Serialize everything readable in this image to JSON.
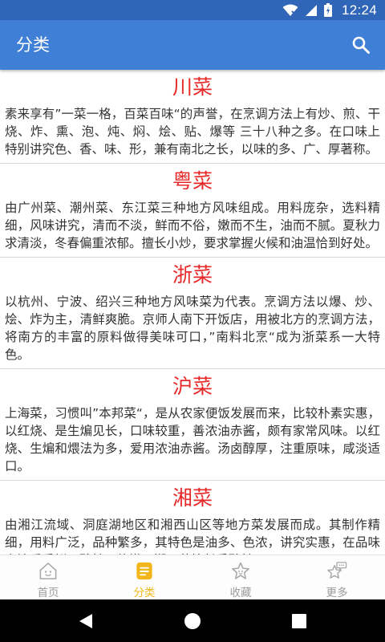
{
  "status_bar": {
    "time": "12:24"
  },
  "app_bar": {
    "title": "分类",
    "search_icon": "search-icon"
  },
  "cuisines": [
    {
      "name": "川菜",
      "desc": "素来享有”一菜一格，百菜百味“的声誉，在烹调方法上有炒、煎、干烧、炸、熏、泡、炖、焖、烩、贴、爆等 三十八种之多。在口味上特别讲究色、香、味、形，兼有南北之长，以味的多、广、厚著称。"
    },
    {
      "name": "粤菜",
      "desc": "由广州菜、潮州菜、东江菜三种地方风味组成。用料庞杂，选料精细，风味讲究，清而不淡，鲜而不俗，嫩而不生，油而不腻。夏秋力求清淡，冬春偏重浓郁。擅长小炒，要求掌握火候和油温恰到好处。"
    },
    {
      "name": "浙菜",
      "desc": "以杭州、宁波、绍兴三种地方风味菜为代表。烹调方法以爆、炒、烩、炸为主，清鲜爽脆。京师人南下开饭店，用被北方的烹调方法，将南方的丰富的原料做得美味可口，”南料北烹“成为浙菜系一大特色。"
    },
    {
      "name": "沪菜",
      "desc": "上海菜，习惯叫”本邦菜“，是从农家便饭发展而来，比较朴素实惠，以红烧、是生煸见长，口味较重，善浓油赤酱，颇有家常风味。以红烧、生煸和煨法为多，爱用浓油赤酱。汤卤醇厚，注重原味，咸淡适口。"
    },
    {
      "name": "湘菜",
      "desc": "由湘江流域、洞庭湖地区和湘西山区等地方菜发展而成。其制作精细，用料广泛，品种繁多，其特色是油多、色浓，讲究实惠，在品味上注重香鲜、酸辣、软嫩。湘西菜擅长香酸辣。"
    }
  ],
  "bottom_nav": [
    {
      "label": "首页",
      "icon": "home-icon",
      "active": false
    },
    {
      "label": "分类",
      "icon": "category-icon",
      "active": true
    },
    {
      "label": "收藏",
      "icon": "star-icon",
      "active": false
    },
    {
      "label": "更多",
      "icon": "more-icon",
      "active": false
    }
  ],
  "colors": {
    "status_bar": "#3066b8",
    "app_bar": "#3f7fd6",
    "title_red": "#e62828",
    "active_yellow": "#f2b619",
    "inactive_gray": "#9c9c9c"
  }
}
